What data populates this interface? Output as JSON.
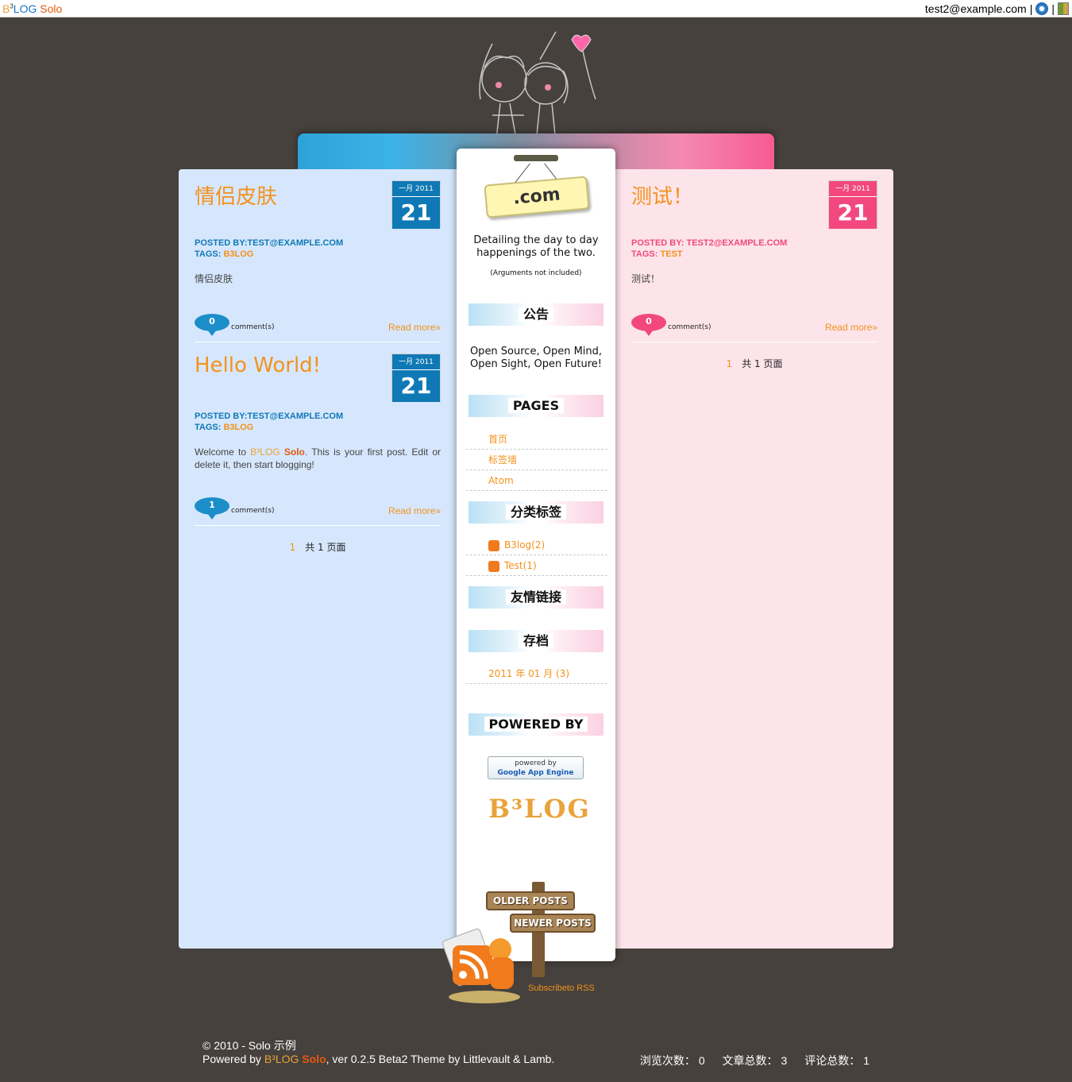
{
  "topbar": {
    "brand_b": "B",
    "brand_sup": "3",
    "brand_log": "LOG",
    "brand_solo": "Solo",
    "user_email": "test2@example.com",
    "separator": "|",
    "icons": [
      "gear-icon",
      "logout-icon"
    ]
  },
  "blog": {
    "tagline": "Detailing the day to day happenings of the two.",
    "tagline_note": "(Arguments not included)",
    "sign_text": ".com"
  },
  "posts_left": [
    {
      "title": "情侣皮肤",
      "month": "一月 2011",
      "day": "21",
      "posted_by": "POSTED BY:TEST@EXAMPLE.COM",
      "tags_label": "TAGS: ",
      "tags": "B3LOG",
      "summary": "情侣皮肤",
      "comments": "0",
      "comments_label": "comment(s)",
      "read_more": "Read more»"
    },
    {
      "title": "Hello World!",
      "month": "一月 2011",
      "day": "21",
      "posted_by": "POSTED BY:TEST@EXAMPLE.COM",
      "tags_label": "TAGS: ",
      "tags": "B3LOG",
      "summary_pre": "Welcome to ",
      "summary_b3": "B³LOG ",
      "summary_solo": "Solo",
      "summary_post": ". This is your first post. Edit or delete it, then start blogging!",
      "comments": "1",
      "comments_label": "comment(s)",
      "read_more": "Read more»"
    }
  ],
  "posts_right": [
    {
      "title": "测试！",
      "month": "一月 2011",
      "day": "21",
      "posted_by": "POSTED BY: TEST2@EXAMPLE.COM",
      "tags_label": "TAGS: ",
      "tags": "TEST",
      "summary": "测试！",
      "comments": "0",
      "comments_label": "comment(s)",
      "read_more": "Read more»"
    }
  ],
  "pager": {
    "page_num": "1",
    "total_label": "共 1 页面"
  },
  "sidebar": {
    "notice_title": "公告",
    "notice_text": "Open Source, Open Mind, Open Sight, Open Future!",
    "pages_title": "PAGES",
    "pages": [
      "首页",
      "标签墙",
      "Atom"
    ],
    "tags_title": "分类标签",
    "tags": [
      "B3log(2)",
      "Test(1)"
    ],
    "links_title": "友情链接",
    "archive_title": "存档",
    "archives": [
      "2011 年 01 月 (3)"
    ],
    "powered_title": "POWERED BY",
    "gae_line1": "powered by",
    "gae_line2": "Google App Engine",
    "b3log_logo": "B³LOG"
  },
  "signpost": {
    "older": "OLDER POSTS",
    "newer": "NEWER POSTS"
  },
  "subscribe": "Subscribeto RSS",
  "footer": {
    "copyright": "© 2010 - Solo 示例",
    "powered_pre": "Powered by ",
    "powered_b3": "B³LOG ",
    "powered_solo": "Solo",
    "powered_post": ", ver 0.2.5 Beta2   Theme by Littlevault & Lamb.",
    "views_label": "浏览次数：",
    "views": "0",
    "articles_label": "文章总数：",
    "articles": "3",
    "comments_label": "评论总数：",
    "comments": "1"
  }
}
